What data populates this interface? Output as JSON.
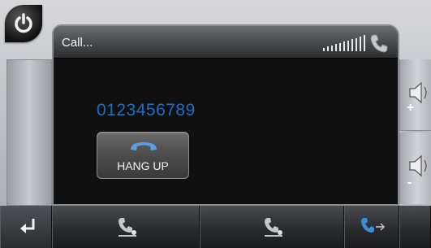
{
  "header": {
    "title": "Call...",
    "signal_bars": 11
  },
  "call": {
    "number": "0123456789",
    "hangup_label": "HANG UP"
  },
  "volume": {
    "up_sign": "+",
    "down_sign": "-"
  },
  "icons": {
    "power": "power-icon",
    "back": "back-arrow-icon",
    "phone": "phone-icon",
    "transfer": "phone-transfer-icon",
    "volume": "speaker-icon"
  },
  "colors": {
    "number": "#1a6fc4",
    "panel": "#101010"
  }
}
